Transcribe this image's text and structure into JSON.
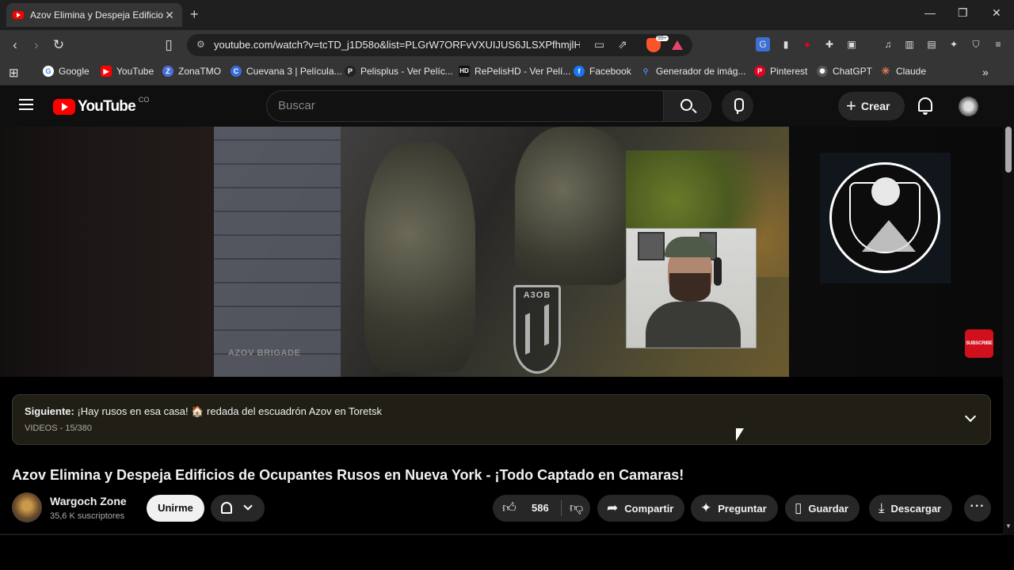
{
  "browser": {
    "tab_title": "Azov Elimina y Despeja Edificios",
    "url": "youtube.com/watch?v=tcTD_j1D58o&list=PLGrW7ORFvVXUIJUS6JLSXPfhmjlH...",
    "brave_badge": "99+",
    "bookmarks": [
      {
        "label": "Google",
        "color": "#ffffff"
      },
      {
        "label": "YouTube",
        "color": "#ff0000"
      },
      {
        "label": "ZonaTMO",
        "color": "#4a6fd8"
      },
      {
        "label": "Cuevana 3 | Película...",
        "color": "#3a6cd8"
      },
      {
        "label": "Pelisplus - Ver Pelíc...",
        "color": "#222222"
      },
      {
        "label": "RePelisHD - Ver Pelí...",
        "color": "#111111"
      },
      {
        "label": "Facebook",
        "color": "#1877f2"
      },
      {
        "label": "Generador de imág...",
        "color": "#2a6cd8"
      },
      {
        "label": "Pinterest",
        "color": "#e60023"
      },
      {
        "label": "ChatGPT",
        "color": "#555555"
      },
      {
        "label": "Claude",
        "color": "#d97757"
      }
    ]
  },
  "youtube": {
    "logo_text": "YouTube",
    "country": "CO",
    "search_placeholder": "Buscar",
    "create_label": "Crear"
  },
  "player": {
    "watermark": "AZOV BRIGADE",
    "emblem_text": "A3OB",
    "subscribe_badge": "SUBSCRIBE"
  },
  "playlist": {
    "next_prefix": "Siguiente:",
    "next_title": "¡Hay rusos en esa casa! 🏠 redada del escuadrón Azov en Toretsk",
    "count": "VIDEOS - 15/380"
  },
  "video": {
    "title": "Azov Elimina y Despeja Edificios de Ocupantes Rusos en Nueva York - ¡Todo Captado en Camaras!",
    "channel": "Wargoch Zone",
    "subscribers": "35,6 K suscriptores",
    "join_label": "Unirme",
    "likes": "586",
    "share_label": "Compartir",
    "ask_label": "Preguntar",
    "save_label": "Guardar",
    "download_label": "Descargar"
  }
}
